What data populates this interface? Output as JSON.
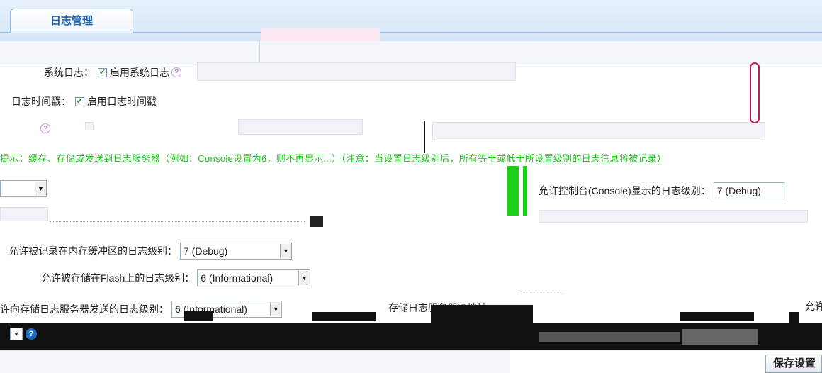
{
  "tab": {
    "label": "日志管理"
  },
  "settings": {
    "syslog": {
      "label": "系统日志：",
      "checked": true,
      "option": "启用系统日志"
    },
    "timestamp": {
      "label": "日志时间戳：",
      "checked": true,
      "option": "启用日志时间戳"
    }
  },
  "notice": "提示：缓存、存储或发送到日志服务器（例如：Console设置为6，则不再显示...）（注意：当设置日志级别后，所有等于或低于所设置级别的日志信息将被记录）",
  "levels": {
    "console": {
      "label": "允许控制台(Console)显示的日志级别：",
      "value": "7 (Debug)"
    },
    "buffer": {
      "label": "允许被记录在内存缓冲区的日志级别：",
      "value": "7 (Debug)"
    },
    "flash": {
      "label": "允许被存储在Flash上的日志级别：",
      "value": "6 (Informational)"
    },
    "server": {
      "label": "许向存储日志服务器发送的日志级别：",
      "value": "6 (Informational)"
    }
  },
  "server_ip": {
    "label": "存储日志服务器IP地址："
  },
  "right_truncated": "允许",
  "save_button": "保存设置",
  "colors": {
    "accent": "#1a63b0",
    "notice": "#21c021",
    "scroll": "#c2185b"
  }
}
